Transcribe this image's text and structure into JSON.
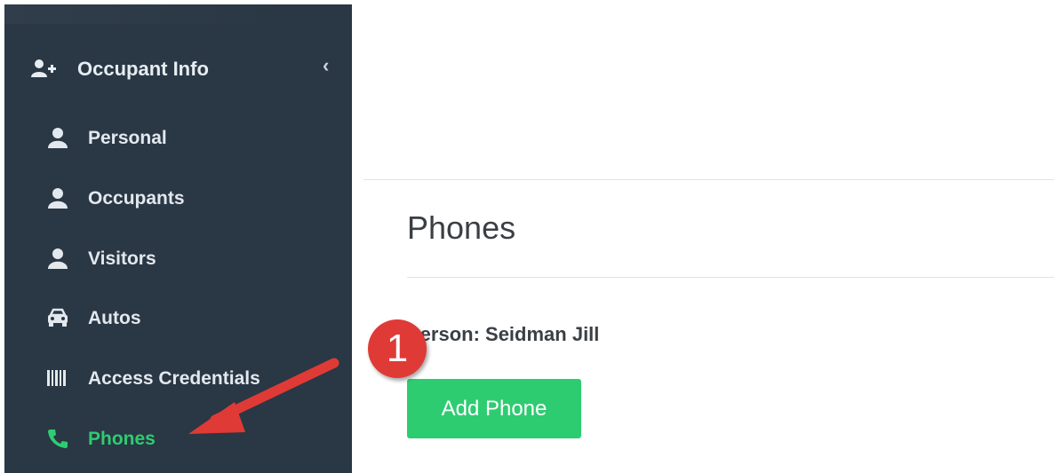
{
  "sidebar": {
    "header": {
      "label": "Occupant Info",
      "icon": "add-user-icon",
      "collapse_glyph": "‹"
    },
    "items": [
      {
        "label": "Personal",
        "icon": "user-icon",
        "active": false
      },
      {
        "label": "Occupants",
        "icon": "user-icon",
        "active": false
      },
      {
        "label": "Visitors",
        "icon": "user-icon",
        "active": false
      },
      {
        "label": "Autos",
        "icon": "car-icon",
        "active": false
      },
      {
        "label": "Access Credentials",
        "icon": "barcode-icon",
        "active": false
      },
      {
        "label": "Phones",
        "icon": "phone-icon",
        "active": true
      }
    ]
  },
  "main": {
    "title": "Phones",
    "person_label": "Person: Seidman Jill",
    "add_button": "Add Phone"
  },
  "annotation": {
    "step_number": "1"
  },
  "colors": {
    "sidebar_bg": "#2a3744",
    "active": "#2ecc71",
    "button": "#2ecc71",
    "badge": "#e03a36",
    "arrow": "#e03a36"
  }
}
